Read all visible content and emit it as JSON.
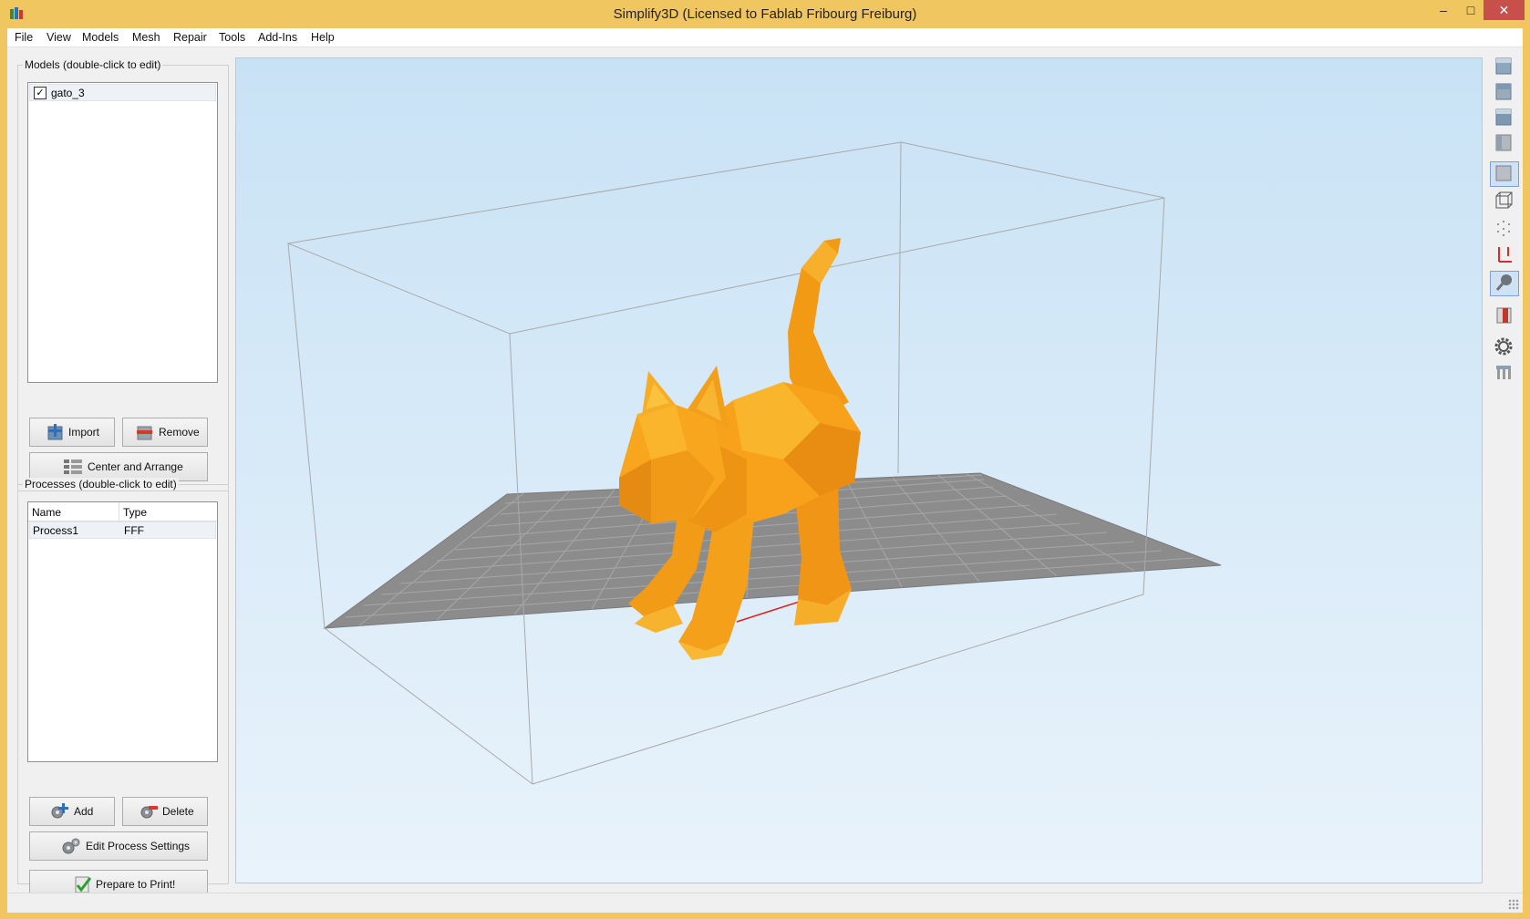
{
  "window": {
    "title": "Simplify3D (Licensed to Fablab Fribourg Freiburg)",
    "controls": {
      "minimize": "–",
      "maximize": "□",
      "close": "✕"
    }
  },
  "menu": [
    "File",
    "View",
    "Models",
    "Mesh",
    "Repair",
    "Tools",
    "Add-Ins",
    "Help"
  ],
  "models_panel": {
    "title": "Models (double-click to edit)",
    "items": [
      {
        "name": "gato_3",
        "checked": true
      }
    ],
    "buttons": {
      "import": "Import",
      "remove": "Remove",
      "center": "Center and Arrange"
    }
  },
  "processes_panel": {
    "title": "Processes (double-click to edit)",
    "columns": [
      "Name",
      "Type"
    ],
    "rows": [
      {
        "name": "Process1",
        "type": "FFF"
      }
    ],
    "buttons": {
      "add": "Add",
      "delete": "Delete",
      "edit": "Edit Process Settings",
      "prepare": "Prepare to Print!"
    }
  },
  "colors": {
    "titlebar": "#f0c660",
    "model": "#f5a21a",
    "viewport_bg": "#cfe6f7",
    "bed": "#8c8c8c"
  },
  "viewport": {
    "model_name": "gato_3"
  },
  "right_toolbar": {
    "icons": [
      "view-default-icon",
      "view-top-icon",
      "view-front-icon",
      "view-side-icon",
      "solid-mode-icon",
      "wireframe-mode-icon",
      "point-mode-icon",
      "axes-icon",
      "lighting-icon",
      "cross-section-icon",
      "settings-gear-icon",
      "supports-icon"
    ],
    "active": [
      "solid-mode-icon",
      "lighting-icon"
    ]
  }
}
